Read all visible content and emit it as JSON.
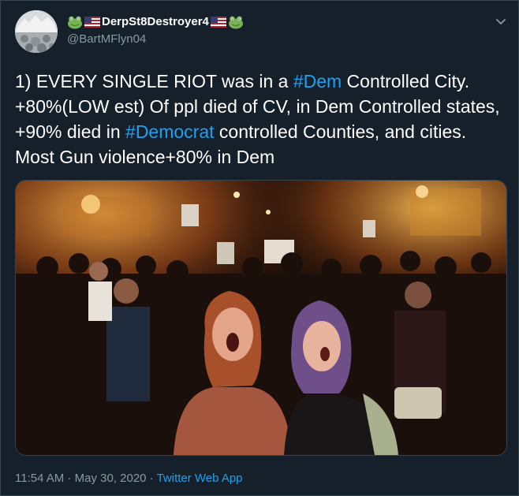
{
  "author": {
    "name_left_emojis": [
      "frog-emoji",
      "us-flag-emoji"
    ],
    "name_text": "DerpSt8Destroyer4",
    "name_right_emojis": [
      "us-flag-emoji",
      "frog-emoji"
    ],
    "handle": "@BartMFlyn04"
  },
  "tweet": {
    "line1_a": "1) EVERY SINGLE RIOT was in a ",
    "hashtag1": "#Dem",
    "line1_b": " Controlled City. +80%(LOW est) Of ppl died of CV, in Dem Controlled states, +90% died in ",
    "hashtag2": "#Democrat",
    "line1_c": " controlled Counties, and cities. Most Gun violence+80% in Dem"
  },
  "meta": {
    "time": "11:54 AM",
    "sep1": " · ",
    "date": "May 30, 2020",
    "sep2": " · ",
    "app": "Twitter Web App"
  },
  "colors": {
    "background": "#15202b",
    "link": "#1da1f2",
    "secondary_text": "#8899a6",
    "border": "#38444d"
  }
}
